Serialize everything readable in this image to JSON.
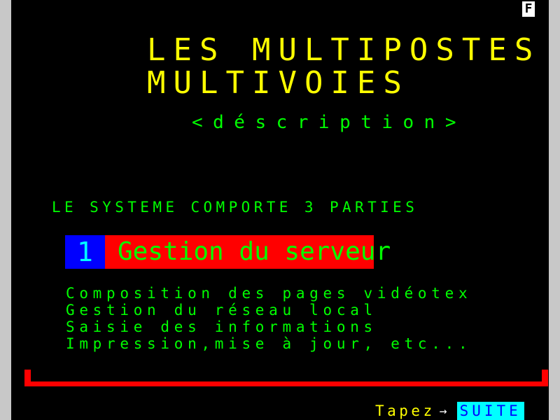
{
  "page_indicator": "F",
  "title": {
    "line1": "LES MULTIPOSTES",
    "line2": "MULTIVOIES"
  },
  "subtitle": "<déscription>",
  "intro": "LE SYSTEME COMPORTE 3 PARTIES",
  "section": {
    "number": "1",
    "title": "Gestion du serveur"
  },
  "items": [
    "Composition des pages vidéotex",
    "Gestion du réseau local",
    "Saisie des informations",
    "Impression,mise à jour, etc..."
  ],
  "footer": {
    "prompt": "Tapez",
    "arrow_icon": "arrow-right-icon",
    "key_label": "SUITE"
  },
  "colors": {
    "background": "#000000",
    "title": "#ffff00",
    "text": "#00ff00",
    "section_number_bg": "#0000ff",
    "section_title_bg": "#ff0000",
    "bracket": "#ff0000",
    "key_bg": "#00ffff",
    "key_text": "#0000ff"
  }
}
